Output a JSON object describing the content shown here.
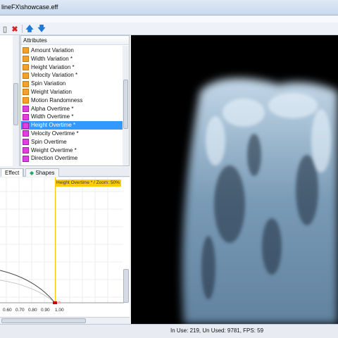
{
  "window": {
    "title": "lineFX\\showcase.eff"
  },
  "toolbar": {
    "delete_icon": "x-icon",
    "up_icon": "arrow-up-icon",
    "down_icon": "arrow-down-icon"
  },
  "attributes": {
    "header": "Attributes",
    "items": [
      {
        "label": "Amount Variation",
        "icon": "orange"
      },
      {
        "label": "Width Variation *",
        "icon": "orange"
      },
      {
        "label": "Height Variation *",
        "icon": "orange"
      },
      {
        "label": "Velocity Variation *",
        "icon": "orange"
      },
      {
        "label": "Spin Variation",
        "icon": "orange"
      },
      {
        "label": "Weight Variation",
        "icon": "orange"
      },
      {
        "label": "Motion Randomness",
        "icon": "orange"
      },
      {
        "label": "Alpha Overtime *",
        "icon": "magenta"
      },
      {
        "label": "Width Overtime *",
        "icon": "magenta"
      },
      {
        "label": "Height Overtime *",
        "icon": "magenta",
        "selected": true
      },
      {
        "label": "Velocity Overtime *",
        "icon": "magenta"
      },
      {
        "label": "Spin Overtime",
        "icon": "magenta"
      },
      {
        "label": "Weight Overtime *",
        "icon": "magenta"
      },
      {
        "label": "Direction Overtime",
        "icon": "magenta"
      }
    ]
  },
  "tabs": [
    {
      "label": "Effect"
    },
    {
      "label": "Shapes"
    }
  ],
  "curve": {
    "header": "Height Overtime * / Zoom: 50%",
    "x_ticks": [
      "0.60",
      "0.70",
      "0.80",
      "0.90",
      "1.00"
    ]
  },
  "status": {
    "text": "In Use: 219, Un Used: 9781, FPS: 59"
  },
  "colors": {
    "selection": "#3399ff",
    "curve_header": "#ffcc00",
    "preview_bg": "#000000"
  }
}
